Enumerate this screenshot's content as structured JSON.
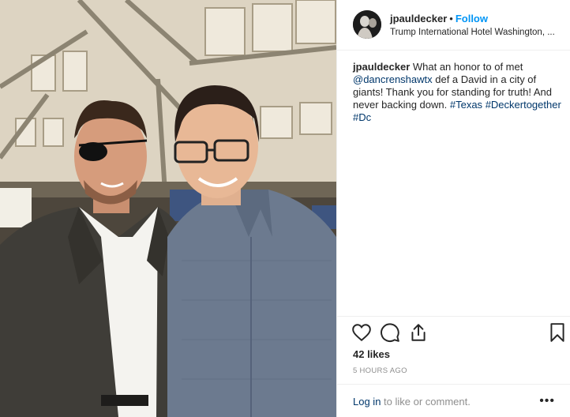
{
  "post": {
    "photo_alt": "",
    "header": {
      "username": "jpauldecker",
      "separator": "•",
      "follow_label": "Follow",
      "location": "Trump International Hotel Washington, ..."
    },
    "caption": {
      "username": "jpauldecker",
      "text_1": " What an honor to of met ",
      "mention": "@dancrenshawtx",
      "text_2": " def a David in a city of giants! Thank you for standing for truth! And never backing down. ",
      "hashtag_1": "#Texas",
      "hashtag_2": "#Deckertogether",
      "hashtag_3": "#Dc"
    },
    "actions": {
      "like_icon": "heart-icon",
      "comment_icon": "comment-icon",
      "share_icon": "share-icon",
      "save_icon": "bookmark-icon"
    },
    "likes": "42 likes",
    "timestamp": "5 HOURS AGO",
    "comment_bar": {
      "login_link": "Log in",
      "login_suffix": " to like or comment.",
      "more_label": "•••"
    },
    "colors": {
      "link": "#00376b",
      "follow": "#0095f6",
      "muted": "#8e8e8e",
      "text": "#262626"
    }
  }
}
